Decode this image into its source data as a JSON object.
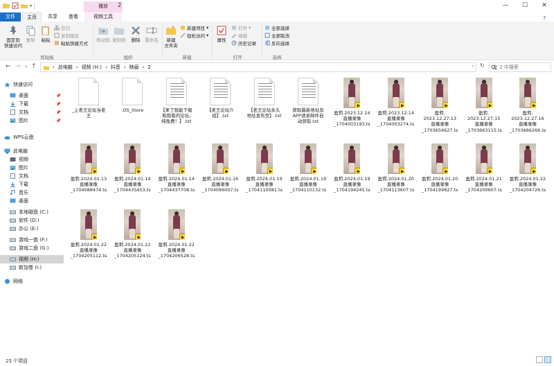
{
  "window": {
    "title": "2",
    "context_tab": "播放",
    "min": "—",
    "max": "☐",
    "close": "✕"
  },
  "tabs": {
    "file": "文件",
    "home": "主页",
    "share": "共享",
    "view": "查看",
    "video_tools": "视频工具"
  },
  "ribbon": {
    "clipboard": {
      "pin": "固定到\n快速访问",
      "copy": "复制",
      "paste": "粘贴",
      "cut": "剪切",
      "copy_path": "复制路径",
      "paste_shortcut": "粘贴快捷方式",
      "label": "剪贴板"
    },
    "organize": {
      "move_to": "移动到",
      "copy_to": "复制到",
      "delete": "删除",
      "rename": "重命名",
      "label": "组织"
    },
    "new": {
      "new_folder": "新建\n文件夹",
      "new_item": "新建项目",
      "easy_access": "轻松访问",
      "label": "新建"
    },
    "open": {
      "properties": "属性",
      "open": "打开",
      "edit": "编辑",
      "history": "历史记录",
      "label": "打开"
    },
    "select": {
      "select_all": "全部选择",
      "select_none": "全部取消",
      "invert": "反向选择",
      "label": "选择"
    }
  },
  "address": {
    "back": "←",
    "forward": "→",
    "recent": "⌄",
    "up": "↑",
    "crumbs": [
      "此电脑",
      "视频 (H:)",
      "抖音",
      "映画",
      "2"
    ],
    "refresh": "↻",
    "search_placeholder": "在 2 中搜索"
  },
  "nav": [
    {
      "label": "快速访问",
      "icon": "star-icon",
      "pin": false
    },
    {
      "label": "桌面",
      "icon": "desktop-icon",
      "pin": true
    },
    {
      "label": "下载",
      "icon": "download-icon",
      "pin": true
    },
    {
      "label": "文档",
      "icon": "document-icon",
      "pin": true
    },
    {
      "label": "图片",
      "icon": "picture-icon",
      "pin": true
    },
    {
      "label": "WPS云盘",
      "icon": "cloud-icon",
      "pin": false
    },
    {
      "label": "此电脑",
      "icon": "computer-icon",
      "pin": false
    },
    {
      "label": "视频",
      "icon": "video-icon",
      "pin": false
    },
    {
      "label": "图片",
      "icon": "picture-icon",
      "pin": false
    },
    {
      "label": "文档",
      "icon": "document-icon",
      "pin": false
    },
    {
      "label": "下载",
      "icon": "download-icon",
      "pin": false
    },
    {
      "label": "音乐",
      "icon": "music-icon",
      "pin": false
    },
    {
      "label": "桌面",
      "icon": "desktop-icon",
      "pin": false
    },
    {
      "label": "本地磁盘 (C:)",
      "icon": "drive-icon",
      "pin": false
    },
    {
      "label": "软件 (D:)",
      "icon": "drive-icon",
      "pin": false
    },
    {
      "label": "办公 (E:)",
      "icon": "drive-icon",
      "pin": false
    },
    {
      "label": "游戏一盘 (F:)",
      "icon": "drive-icon",
      "pin": false
    },
    {
      "label": "游戏二盘 (G:)",
      "icon": "drive-icon",
      "pin": false
    },
    {
      "label": "视频 (H:)",
      "icon": "drive-icon",
      "pin": false,
      "selected": true
    },
    {
      "label": "新加卷 (I:)",
      "icon": "drive-icon",
      "pin": false
    },
    {
      "label": "网络",
      "icon": "network-icon",
      "pin": false
    }
  ],
  "files": [
    {
      "name": "_上老王论坛当老\n王",
      "type": "doc"
    },
    {
      "name": ".DS_Store",
      "type": "doc"
    },
    {
      "name": "【来了就能下载\n和观看的论坛,\n纯免费！】.txt",
      "type": "txt"
    },
    {
      "name": "【老王论坛介\n绍】.txt",
      "type": "txt"
    },
    {
      "name": "【老王论坛永久\n地址发布页】.txt",
      "type": "txt"
    },
    {
      "name": "获取最新地址及\nAPP请发邮件自\n动获取.txt",
      "type": "txt"
    },
    {
      "name": "盈莉.2023.12.14\n直播录像\n_1704003193.ts",
      "type": "video"
    },
    {
      "name": "盈莉.2023.12.14\n直播录像\n_1704003274.ts",
      "type": "video"
    },
    {
      "name": "盈莉.\n2023.12.27.13\n直播录像\n_1703656627.ts",
      "type": "video"
    },
    {
      "name": "盈莉.\n2023.12.27.15\n直播录像\n_1703663115.ts",
      "type": "video"
    },
    {
      "name": "盈莉.\n2023.12.27.16\n直播录像\n_1703666266.ts",
      "type": "video"
    },
    {
      "name": "盈莉.2024.01.13\n直播录像\n_1704088474.ts",
      "type": "video"
    },
    {
      "name": "盈莉.2024.01.14\n直播录像\n_1704435453.ts",
      "type": "video"
    },
    {
      "name": "盈莉.2024.01.14\n直播录像\n_1704437708.ts",
      "type": "video"
    },
    {
      "name": "盈莉.2024.01.16\n直播录像\n_1704096007.ts",
      "type": "video"
    },
    {
      "name": "盈莉.2024.01.19\n直播录像\n_1704110081.ts",
      "type": "video"
    },
    {
      "name": "盈莉.2024.01.19\n直播录像\n_1704110132.ts",
      "type": "video"
    },
    {
      "name": "盈莉.2024.01.19\n直播录像\n_1704194245.ts",
      "type": "video"
    },
    {
      "name": "盈莉.2024.01.20\n直播录像\n_1704113607.ts",
      "type": "video"
    },
    {
      "name": "盈莉.2024.01.20\n直播录像\n_1704199827.ts",
      "type": "video"
    },
    {
      "name": "盈莉.2024.01.21\n直播录像\n_1704200607.ts",
      "type": "video"
    },
    {
      "name": "盈莉.2024.01.22\n直播录像\n_1704204726.ts",
      "type": "video"
    },
    {
      "name": "盈莉.2024.01.22\n直播录像\n_1704205112.ts",
      "type": "video"
    },
    {
      "name": "盈莉.2024.01.22\n直播录像\n_1704205124.ts",
      "type": "video"
    },
    {
      "name": "盈莉.2024.01.22\n直播录像\n_1704206528.ts",
      "type": "video"
    }
  ],
  "status": {
    "count": "25 个项目"
  },
  "colors": {
    "accent": "#1a6fc8",
    "context_tab": "#f5d9ef",
    "badge": "#ffd83a",
    "selection": "#d4d4d4"
  }
}
